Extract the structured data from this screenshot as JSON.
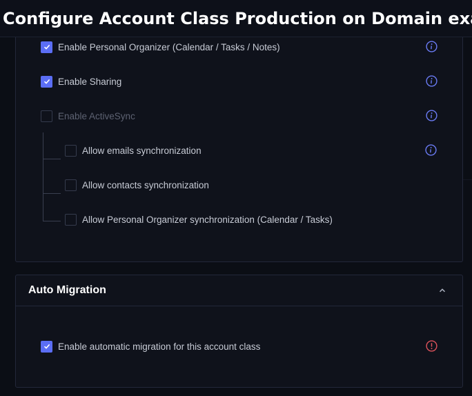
{
  "title": "Configure Account Class Production on Domain exam...",
  "options": [
    {
      "label": "Enable Personal Organizer (Calendar / Tasks / Notes)",
      "checked": true,
      "disabled": false,
      "info": true
    },
    {
      "label": "Enable Sharing",
      "checked": true,
      "disabled": false,
      "info": true
    },
    {
      "label": "Enable ActiveSync",
      "checked": false,
      "disabled": true,
      "info": true
    }
  ],
  "sub_options": [
    {
      "label": "Allow emails synchronization",
      "checked": false,
      "info": true
    },
    {
      "label": "Allow contacts synchronization",
      "checked": false,
      "info": false
    },
    {
      "label": "Allow Personal Organizer synchronization (Calendar / Tasks)",
      "checked": false,
      "info": false
    }
  ],
  "migration": {
    "title": "Auto Migration",
    "option_label": "Enable automatic migration for this account class",
    "checked": true
  },
  "colors": {
    "accent": "#5b6ef5",
    "info_icon": "#6b7cf6",
    "warning_icon": "#e0535c",
    "panel_bg": "#0f121b",
    "page_bg": "#0b0e15"
  },
  "icons": {
    "check": "check-icon",
    "info": "info-icon",
    "collapse": "chevron-up-icon"
  }
}
